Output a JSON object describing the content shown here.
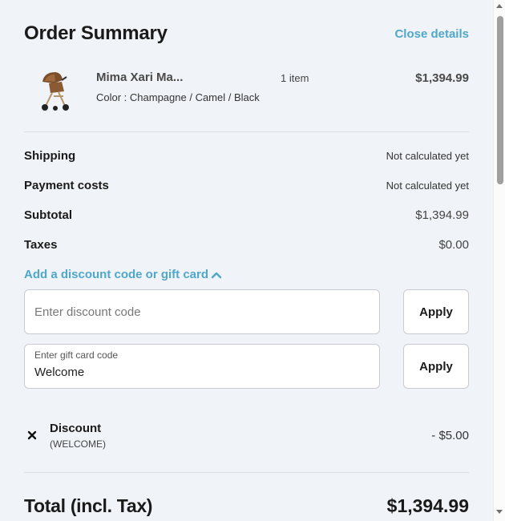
{
  "header": {
    "title": "Order Summary",
    "close_label": "Close details"
  },
  "product": {
    "name": "Mima Xari Ma...",
    "variant": "Color : Champagne / Camel / Black",
    "quantity": "1 item",
    "price": "$1,394.99",
    "image_icon": "stroller-image"
  },
  "summary": {
    "shipping_label": "Shipping",
    "shipping_value": "Not calculated yet",
    "payment_label": "Payment costs",
    "payment_value": "Not calculated yet",
    "subtotal_label": "Subtotal",
    "subtotal_value": "$1,394.99",
    "taxes_label": "Taxes",
    "taxes_value": "$0.00"
  },
  "discount_section": {
    "toggle_label": "Add a discount code or gift card",
    "toggle_icon": "chevron-up-icon",
    "discount_placeholder": "Enter discount code",
    "discount_value": "",
    "discount_apply": "Apply",
    "giftcard_label": "Enter gift card code",
    "giftcard_value": "Welcome",
    "giftcard_apply": "Apply"
  },
  "applied_discount": {
    "title": "Discount",
    "code": "(WELCOME)",
    "amount": "- $5.00",
    "remove_icon": "close-icon"
  },
  "total": {
    "label": "Total (incl. Tax)",
    "value": "$1,394.99"
  },
  "colors": {
    "background": "#f0f3f7",
    "accent": "#4fa7c9",
    "text": "#1a1a1a"
  }
}
